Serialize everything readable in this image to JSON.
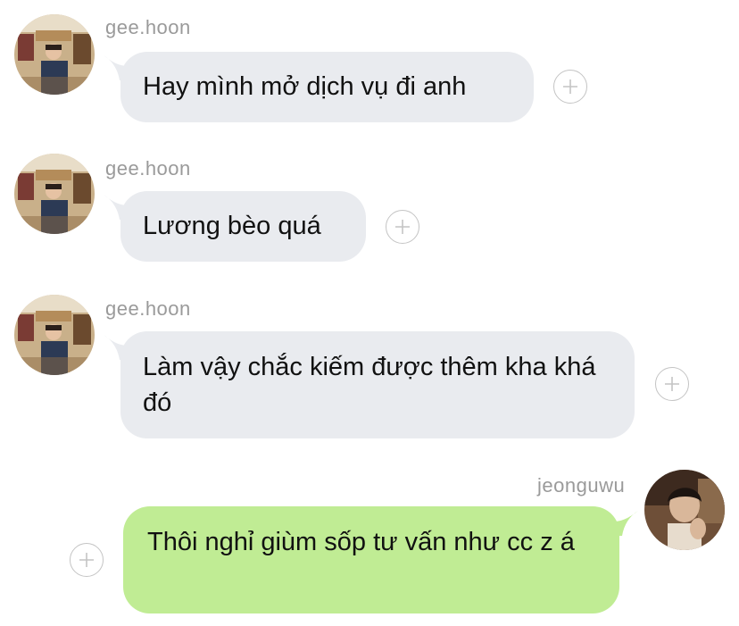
{
  "messages": [
    {
      "sender": "gee.hoon",
      "text": "Hay mình mở dịch vụ đi anh"
    },
    {
      "sender": "gee.hoon",
      "text": "Lương bèo quá"
    },
    {
      "sender": "gee.hoon",
      "text": "Làm vậy chắc kiếm được thêm kha khá đó"
    },
    {
      "sender": "jeonguwu",
      "text": "Thôi nghỉ giùm sốp tư vấn như cc z á"
    }
  ],
  "colors": {
    "incoming_bubble": "#e9ebef",
    "outgoing_bubble": "#c0ec94",
    "username": "#9a9a9a",
    "plus_icon": "#c4c4c4"
  }
}
